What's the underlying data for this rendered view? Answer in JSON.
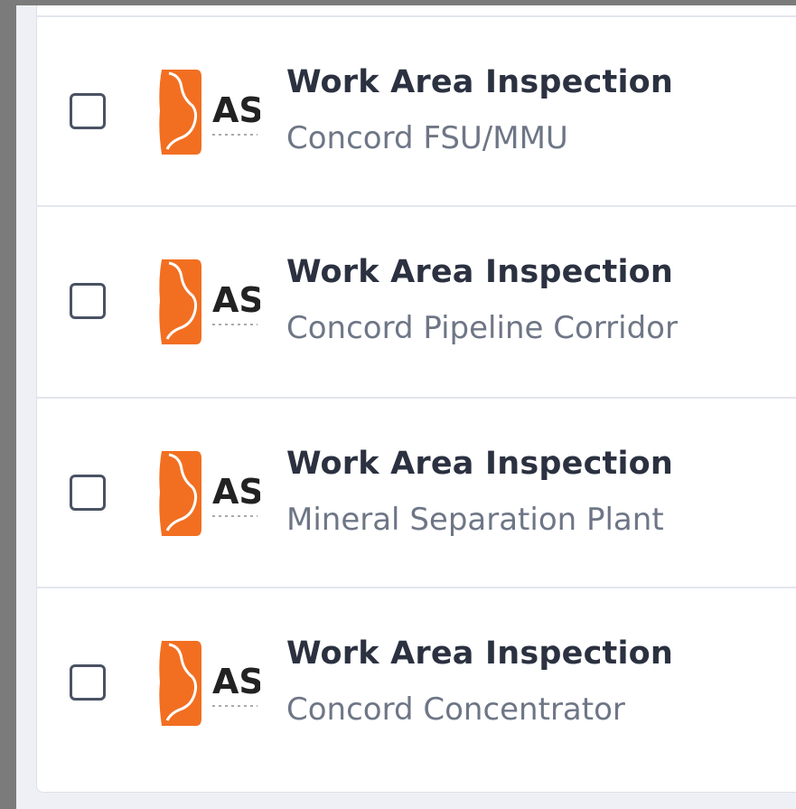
{
  "list": {
    "items": [
      {
        "title": "Work Area Inspection",
        "location": "Concord FSU/MMU"
      },
      {
        "title": "Work Area Inspection",
        "location": "Concord Pipeline Corridor"
      },
      {
        "title": "Work Area Inspection",
        "location": "Mineral Separation Plant"
      },
      {
        "title": "Work Area Inspection",
        "location": "Concord Concentrator"
      }
    ]
  },
  "logo": {
    "letters": "AS",
    "brand_color": "#f26f21"
  },
  "colors": {
    "title": "#2b3140",
    "subtitle": "#6e7686",
    "checkbox_border": "#4a5263",
    "row_divider": "#e3e6ee"
  }
}
